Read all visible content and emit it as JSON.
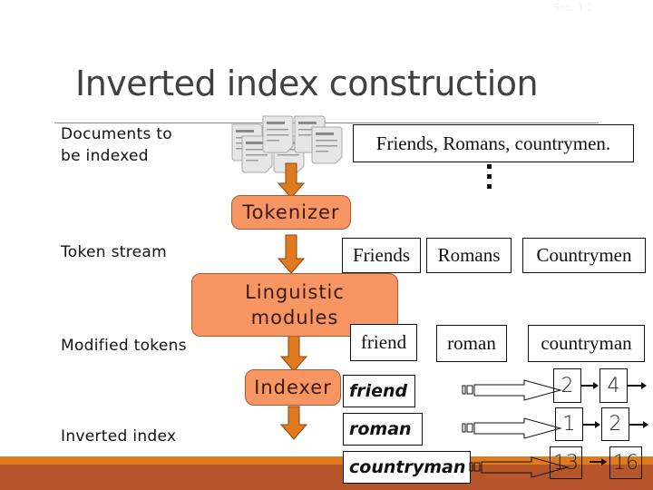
{
  "slide": {
    "number_label": "Sec. 1.2",
    "title": "Inverted index construction"
  },
  "left_labels": {
    "documents": [
      "Documents to",
      "be indexed"
    ],
    "token_stream": "Token stream",
    "modified_tokens": "Modified tokens",
    "inverted_index": "Inverted index"
  },
  "document_sample": "Friends, Romans, countrymen.",
  "processes": {
    "tokenizer": "Tokenizer",
    "linguistic": [
      "Linguistic",
      "modules"
    ],
    "indexer": "Indexer"
  },
  "token_stream": [
    "Friends",
    "Romans",
    "Countrymen"
  ],
  "modified_tokens": [
    "friend",
    "roman",
    "countryman"
  ],
  "inverted_index": [
    {
      "term": "friend",
      "postings": [
        2,
        4
      ]
    },
    {
      "term": "roman",
      "postings": [
        1,
        2
      ]
    },
    {
      "term": "countryman",
      "postings": [
        13,
        16
      ]
    }
  ],
  "colors": {
    "process_fill": "#f79563",
    "arrow_fill": "#e07a1f",
    "footer_orange": "#e07a1f",
    "footer_rust": "#b8562b"
  }
}
